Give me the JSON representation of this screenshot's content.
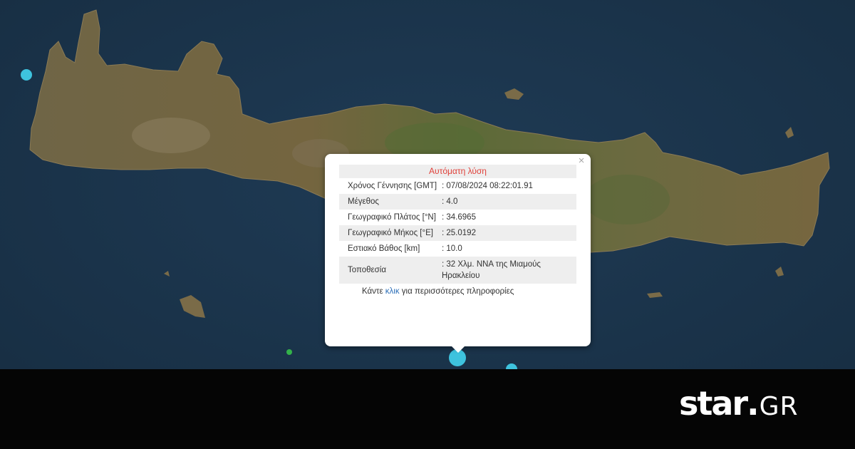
{
  "popup": {
    "title": "Αυτόματη λύση",
    "close_symbol": "×",
    "rows": [
      {
        "label": "Χρόνος Γέννησης [GMT]",
        "value": ": 07/08/2024 08:22:01.91"
      },
      {
        "label": "Μέγεθος",
        "value": ": 4.0"
      },
      {
        "label": "Γεωγραφικό Πλάτος [°N]",
        "value": ": 34.6965"
      },
      {
        "label": "Γεωγραφικό Μήκος [°E]",
        "value": ": 25.0192"
      },
      {
        "label": "Εστιακό Βάθος [km]",
        "value": ": 10.0"
      },
      {
        "label": "Τοποθεσία",
        "value": ": 32 Χλμ. ΝΝΑ της Μιαμούς Ηρακλείου"
      }
    ],
    "more_prefix": "Κάντε ",
    "more_link": "κλικ",
    "more_suffix": " για περισσότερες πληροφορίες"
  },
  "markers": [
    {
      "name": "epicenter-marker",
      "color": "#3ec3de"
    },
    {
      "name": "quake-marker-west",
      "color": "#3ec3de"
    },
    {
      "name": "quake-marker-south-east",
      "color": "#3ec3de"
    },
    {
      "name": "quake-marker-small",
      "color": "#33b24a"
    }
  ],
  "logo": {
    "main": "star",
    "dot": ".",
    "tld": "GR"
  },
  "colors": {
    "sea": "#1a3349",
    "land": "#6e6342",
    "footer": "#050505",
    "popup_title": "#e0413a"
  }
}
